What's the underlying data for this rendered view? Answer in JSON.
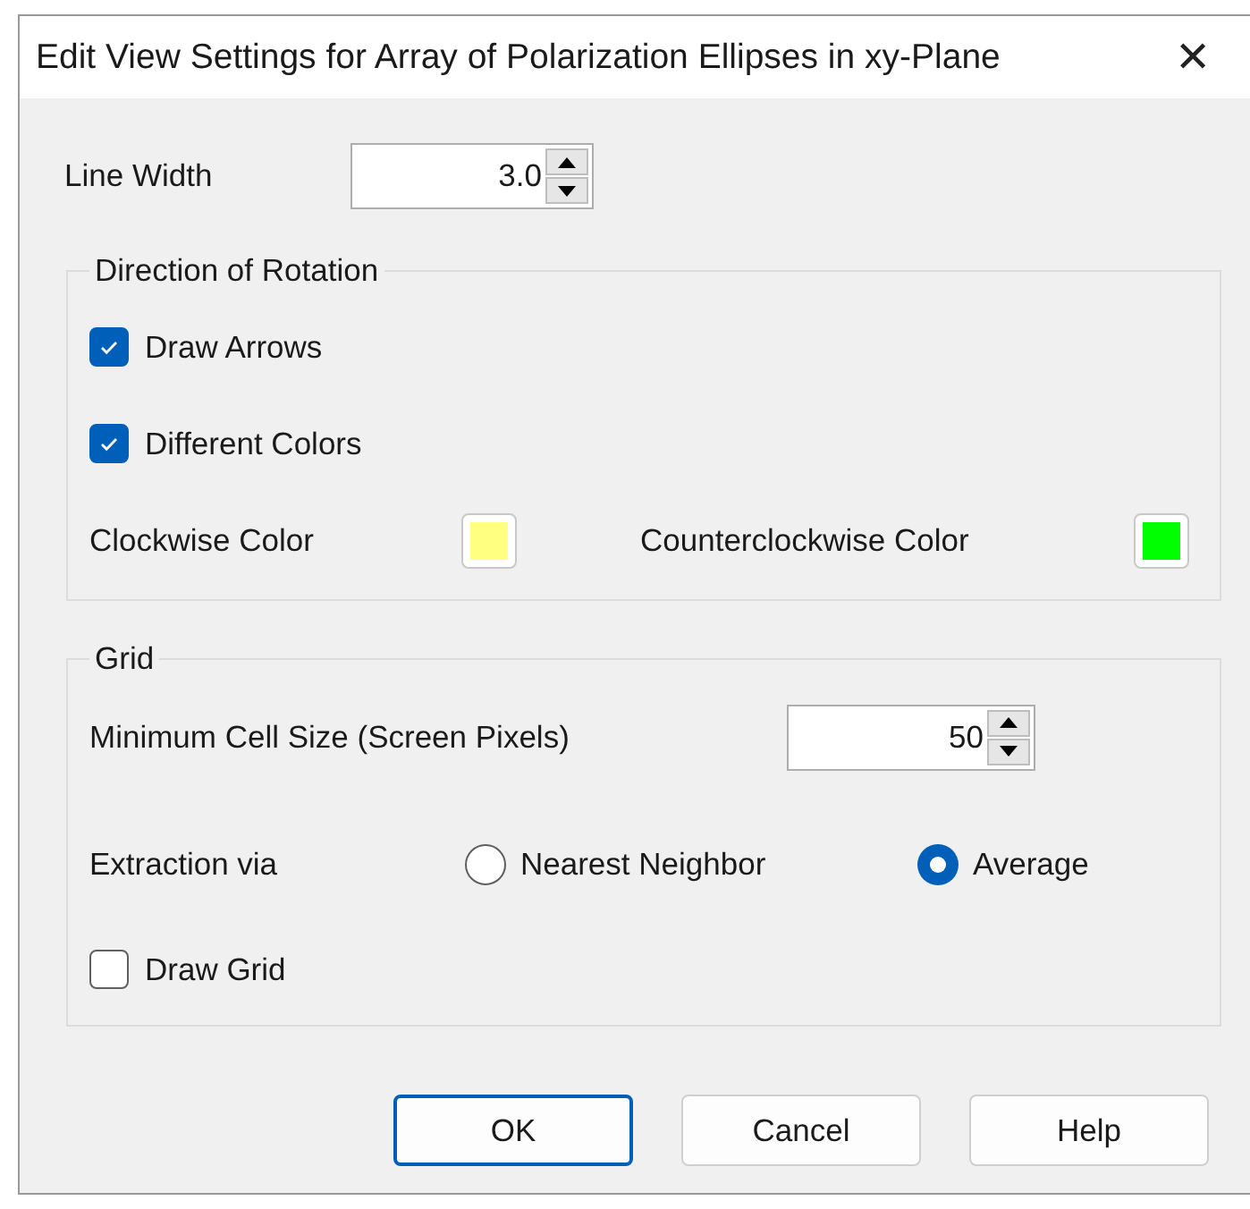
{
  "window": {
    "title": "Edit View Settings for Array of Polarization Ellipses in xy-Plane",
    "close": "✕"
  },
  "line_width": {
    "label": "Line Width",
    "value": "3.0"
  },
  "rotation": {
    "legend": "Direction of Rotation",
    "checkboxes": [
      {
        "label": "Draw Arrows",
        "checked": true
      },
      {
        "label": "Different Colors",
        "checked": true
      }
    ],
    "colors": [
      {
        "label": "Clockwise Color",
        "color": "#ffff80"
      },
      {
        "label": "Counterclockwise Color",
        "color": "#00ff00"
      }
    ]
  },
  "grid": {
    "legend": "Grid",
    "min_cell": {
      "label": "Minimum Cell Size (Screen Pixels)",
      "value": "50"
    },
    "extraction": {
      "label": "Extraction via",
      "options": [
        {
          "label": "Nearest Neighbor",
          "selected": false
        },
        {
          "label": "Average",
          "selected": true
        }
      ]
    },
    "draw_grid": {
      "label": "Draw Grid",
      "checked": false
    }
  },
  "buttons": [
    {
      "label": "OK",
      "default": true
    },
    {
      "label": "Cancel",
      "default": false
    },
    {
      "label": "Help",
      "default": false
    }
  ]
}
